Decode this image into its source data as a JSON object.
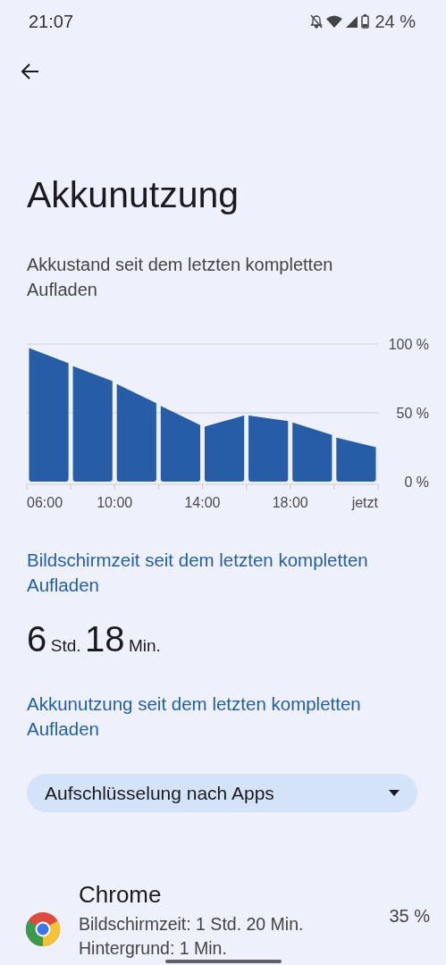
{
  "status_bar": {
    "time": "21:07",
    "battery": "24 %"
  },
  "title": "Akkunutzung",
  "subtitle": "Akkustand seit dem letzten kompletten Aufladen",
  "chart_data": {
    "type": "area",
    "x": [
      6.1,
      7.9,
      8.1,
      9.9,
      10.1,
      11.9,
      12.1,
      13.9,
      14.1,
      15.9,
      16.1,
      17.9,
      18.1,
      19.9,
      20.1,
      21.9
    ],
    "series": [
      {
        "color": "#265da6",
        "values": [
          97,
          86,
          84,
          73,
          71,
          57,
          55,
          41,
          40,
          48,
          48,
          44,
          43,
          34,
          32,
          25
        ]
      }
    ],
    "xlim": [
      6,
      22
    ],
    "ylim": [
      0,
      100
    ],
    "yticks": [
      {
        "value": 0,
        "label": "0 %"
      },
      {
        "value": 50,
        "label": "50 %"
      },
      {
        "value": 100,
        "label": "100 %"
      }
    ],
    "xticks": [
      {
        "value": 6,
        "label": "06:00"
      },
      {
        "value": 10,
        "label": "10:00"
      },
      {
        "value": 14,
        "label": "14:00"
      },
      {
        "value": 18,
        "label": "18:00"
      },
      {
        "value": 22,
        "label": "jetzt"
      }
    ]
  },
  "screen_time": {
    "heading": "Bildschirmzeit seit dem letzten kompletten Aufladen",
    "hours": "6",
    "hours_unit": "Std.",
    "minutes": "18",
    "minutes_unit": "Min."
  },
  "usage_heading": "Akkunutzung seit dem letzten kompletten Aufladen",
  "dropdown": {
    "value": "Aufschlüsselung nach Apps"
  },
  "apps": [
    {
      "name": "Chrome",
      "screen_time": "Bildschirmzeit: 1 Std. 20 Min.",
      "background": "Hintergrund: 1 Min.",
      "percent": "35 %"
    }
  ]
}
